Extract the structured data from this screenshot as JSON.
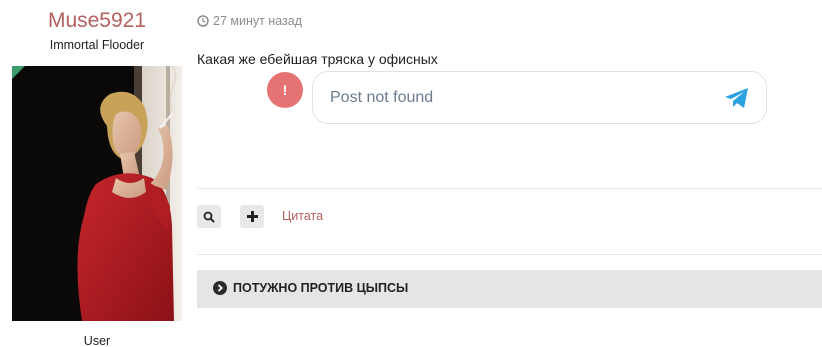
{
  "user": {
    "username": "Muse5921",
    "title": "Immortal Flooder",
    "role": "User"
  },
  "post": {
    "time_icon": "clock-icon",
    "time": "27 минут назад",
    "text": "Какая же ебейшая тряска у офисных",
    "embed": {
      "error_icon": "exclamation",
      "error_symbol": "!",
      "message": "Post not found",
      "service_icon": "telegram-icon"
    }
  },
  "actions": {
    "search_icon": "search-icon",
    "plus_icon": "plus-icon",
    "quote_label": "Цитата"
  },
  "signature": {
    "icon": "chevron-right-circle-icon",
    "text": "ПОТУЖНО ПРОТИВ ЦЫПСЫ"
  },
  "colors": {
    "username": "#b5615e",
    "link": "#b5615e",
    "error_badge": "#e57373",
    "telegram": "#2aa3e0",
    "online": "#3c9c6b",
    "signature_bg": "#e5e5e5"
  }
}
